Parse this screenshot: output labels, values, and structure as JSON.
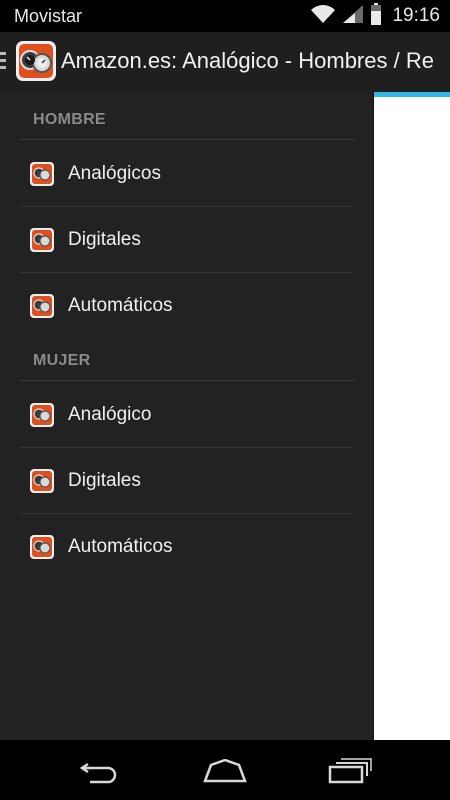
{
  "status_bar": {
    "carrier": "Movistar",
    "time": "19:16",
    "icons": [
      "wifi-icon",
      "signal-icon",
      "battery-icon"
    ]
  },
  "action_bar": {
    "title": "Amazon.es: Analógico - Hombres / Re",
    "app_icon": "watch-app-icon"
  },
  "drawer": {
    "sections": [
      {
        "header": "HOMBRE",
        "items": [
          {
            "label": "Analógicos",
            "icon": "watch-icon"
          },
          {
            "label": "Digitales",
            "icon": "watch-icon"
          },
          {
            "label": "Automáticos",
            "icon": "watch-icon"
          }
        ]
      },
      {
        "header": "MUJER",
        "items": [
          {
            "label": "Analógico",
            "icon": "watch-icon"
          },
          {
            "label": "Digitales",
            "icon": "watch-icon"
          },
          {
            "label": "Automáticos",
            "icon": "watch-icon"
          }
        ]
      }
    ]
  },
  "nav_bar": {
    "buttons": [
      "back-icon",
      "home-icon",
      "recent-apps-icon"
    ]
  },
  "colors": {
    "accent": "#33b5e5",
    "drawer_bg": "#222222",
    "action_bar_bg": "#1f1f1f"
  }
}
